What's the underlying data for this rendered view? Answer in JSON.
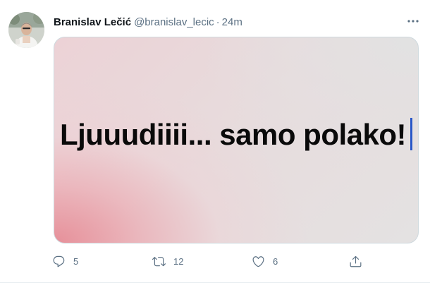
{
  "tweet": {
    "author": {
      "display_name": "Branislav Lečić",
      "handle": "@branislav_lecic"
    },
    "separator": "·",
    "timestamp": "24m",
    "media": {
      "text": "Ljuuudiiii... samo polako!"
    },
    "actions": {
      "reply": {
        "icon": "reply-icon",
        "count": "5"
      },
      "retweet": {
        "icon": "retweet-icon",
        "count": "12"
      },
      "like": {
        "icon": "heart-icon",
        "count": "6"
      },
      "share": {
        "icon": "share-icon"
      }
    },
    "colors": {
      "text_primary": "#0f1419",
      "text_secondary": "#5b7083",
      "caret": "#2a58c8"
    }
  }
}
